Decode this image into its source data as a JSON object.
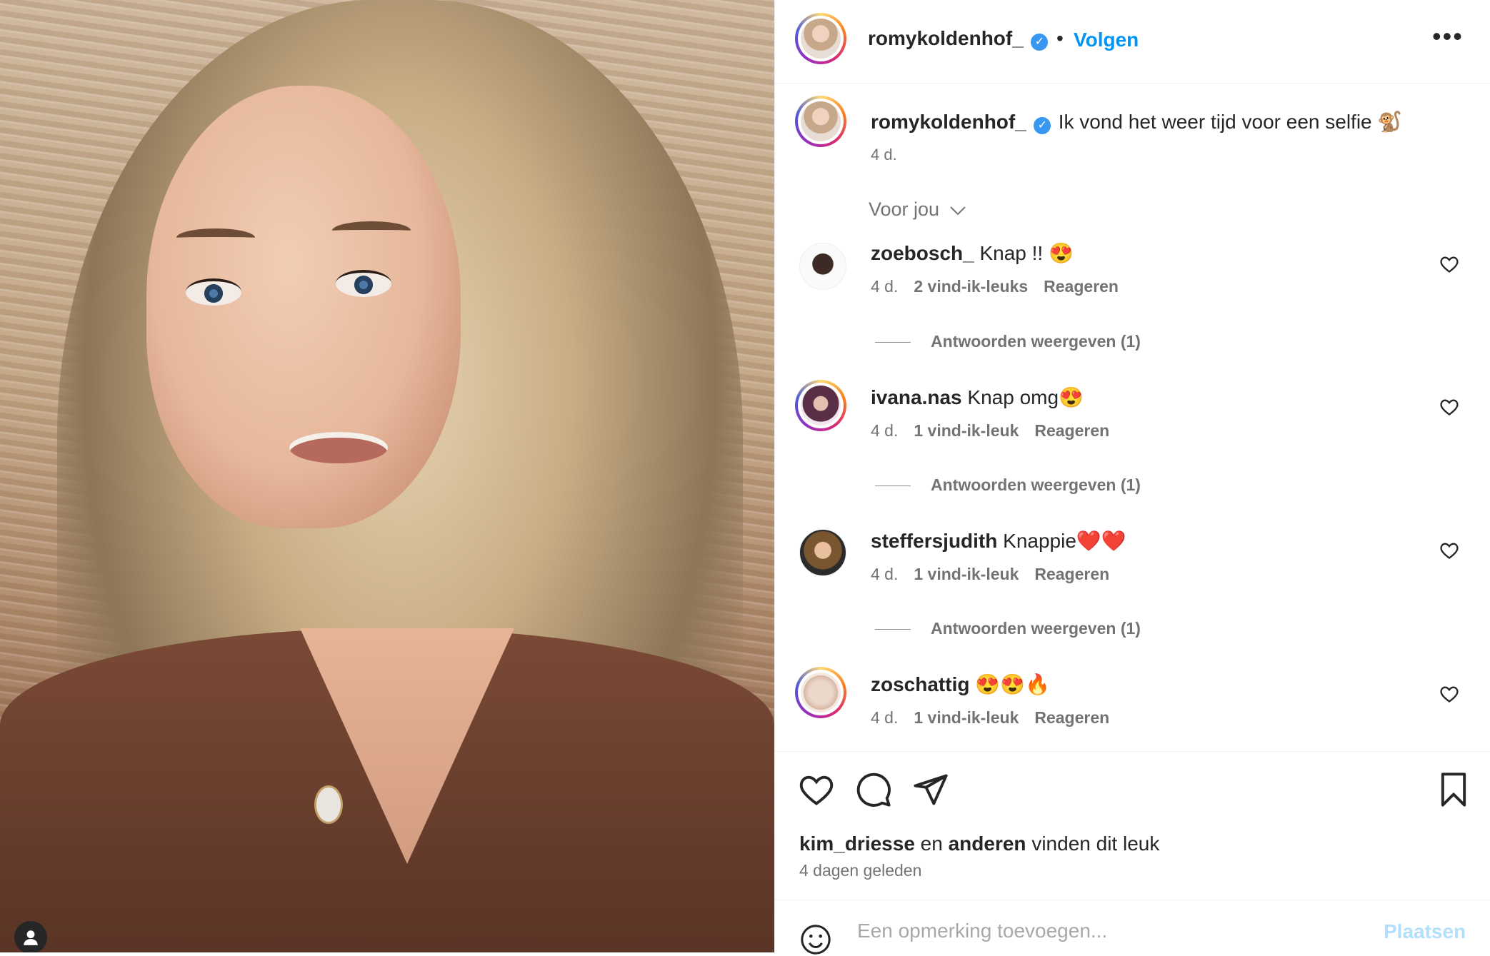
{
  "post": {
    "author": "romykoldenhof_",
    "follow_label": "Volgen",
    "separator": "•",
    "more_label": "•••",
    "caption": "Ik vond het weer tijd voor een selfie 🐒",
    "caption_time": "4 d.",
    "for_you_label": "Voor jou"
  },
  "comments": [
    {
      "user": "zoebosch_",
      "text": "Knap !! 😍",
      "time": "4 d.",
      "likes": "2 vind-ik-leuks",
      "reply": "Reageren",
      "view_replies": "Antwoorden weergeven (1)"
    },
    {
      "user": "ivana.nas",
      "text": "Knap omg😍",
      "time": "4 d.",
      "likes": "1 vind-ik-leuk",
      "reply": "Reageren",
      "view_replies": "Antwoorden weergeven (1)"
    },
    {
      "user": "steffersjudith",
      "text": "Knappie❤️❤️",
      "time": "4 d.",
      "likes": "1 vind-ik-leuk",
      "reply": "Reageren",
      "view_replies": "Antwoorden weergeven (1)"
    },
    {
      "user": "zoschattig",
      "text": "😍😍🔥",
      "time": "4 d.",
      "likes": "1 vind-ik-leuk",
      "reply": "Reageren"
    }
  ],
  "likes_summary": {
    "user1": "kim_driesse",
    "and": "en",
    "others": "anderen",
    "suffix": "vinden dit leuk"
  },
  "post_time": "4 dagen geleden",
  "add_comment": {
    "placeholder": "Een opmerking toevoegen...",
    "submit": "Plaatsen"
  },
  "colors": {
    "accent": "#0095f6",
    "verified": "#3897f0",
    "muted": "#737373"
  },
  "icons": [
    "heart-icon",
    "comment-icon",
    "share-icon",
    "bookmark-icon",
    "emoji-icon",
    "verified-icon",
    "user-tag-icon"
  ]
}
